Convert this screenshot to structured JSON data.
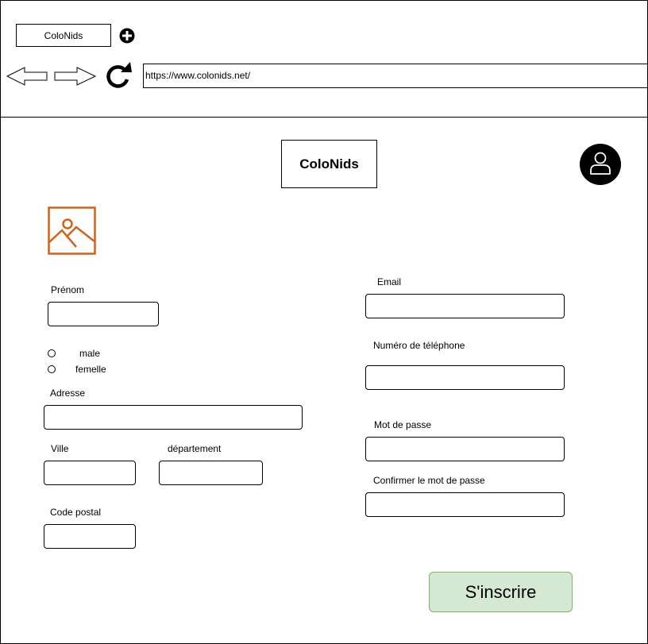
{
  "browser": {
    "tab_title": "ColoNids",
    "url": "https://www.colonids.net/"
  },
  "header": {
    "logo_text": "ColoNids"
  },
  "form": {
    "prenom_label": "Prénom",
    "gender_options": [
      "male",
      "femelle"
    ],
    "adresse_label": "Adresse",
    "ville_label": "Ville",
    "departement_label": "département",
    "code_postal_label": "Code postal",
    "email_label": "Email",
    "telephone_label": "Numéro de téléphone",
    "password_label": "Mot de passe",
    "confirm_password_label": "Confirmer le mot de passe",
    "submit_label": "S'inscrire"
  },
  "colors": {
    "image_placeholder": "#d0621b",
    "submit_bg": "#d5e8d4",
    "submit_border": "#82b366"
  }
}
